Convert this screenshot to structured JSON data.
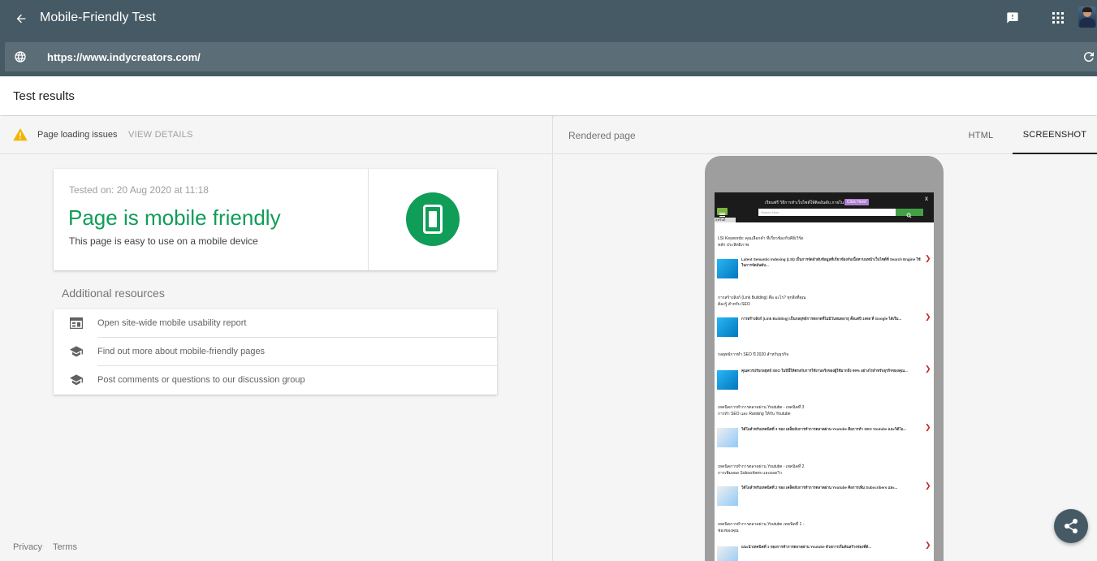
{
  "app": {
    "title": "Mobile-Friendly Test",
    "url": "https://www.indycreators.com/"
  },
  "results": {
    "title": "Test results"
  },
  "issues": {
    "text": "Page loading issues",
    "action": "VIEW DETAILS"
  },
  "result_card": {
    "tested_on": "Tested on: 20 Aug 2020 at 11:18",
    "verdict": "Page is mobile friendly",
    "subtitle": "This page is easy to use on a mobile device",
    "verdict_color": "#0f9d58"
  },
  "resources": {
    "title": "Additional resources",
    "items": [
      {
        "label": "Open site-wide mobile usability report",
        "icon": "report-icon"
      },
      {
        "label": "Find out more about mobile-friendly pages",
        "icon": "school-icon"
      },
      {
        "label": "Post comments or questions to our discussion group",
        "icon": "school-icon"
      }
    ]
  },
  "footer": {
    "privacy": "Privacy",
    "terms": "Terms"
  },
  "rendered": {
    "title": "Rendered page",
    "tabs": [
      "HTML",
      "SCREENSHOT"
    ],
    "active_tab": "SCREENSHOT"
  },
  "preview": {
    "banner_text": "เรียนฟรี วิธีการทำเว็บไซต์ให้ติดอันดับ ภายใน 1 วัน",
    "click_here": "Click Here!",
    "close": "x",
    "search_placeholder": "Search Here",
    "lang": "สคริปต์",
    "posts": [
      {
        "title": "LSI Keywords: คุณเลือกคำ ที่เกี่ยวข้องกับคีย์เวิร์ดหลัก ประสิทธิภาพ",
        "excerpt": "Latent Semantic Indexing (LSI) เป็นการจัดลำดับข้อมูลที่เกี่ยวข้องกับเนื้อหาบนหน้าเว็บไซต์ที่ Search Engine ใช้ในการจัดอันดับ..."
      },
      {
        "title": "การสร้างลิงก์ (Link Building) คือ อะไร? ทุกสิ่งที่คุณต้องรู้ สำหรับ SEO",
        "excerpt": "การสร้างลิงก์ (Link Building) เป็นกลยุทธ์การตลาดที่ไม่มีวันหมดอายุ ตั้งแต่ปี 1998 ที่ Google ได้เริ่ม..."
      },
      {
        "title": "กลยุทธ์การทำ SEO ปี 2020 สำหรับธุรกิจ",
        "excerpt": "คุณควรปรับกลยุทธ์ SEO ในปีนี้ให้ตรงกับการใช้งานจริงของผู้ใช้มากถึง 99% อย่างไรสำหรับธุรกิจของคุณ..."
      },
      {
        "title": "เทคนิคการทำการตลาดผ่าน Youtube - เทคนิคที่ 3 การทำ SEO และ Ranking ให้กับ Youtube",
        "excerpt": "วิดีโอสำหรับเทคนิคที่ 3 ของ เคล็ดลับการทำการตลาดผ่าน Youtube คือการทำ SEO Youtube และวิดีโอ..."
      },
      {
        "title": "เทคนิคการทำการตลาดผ่าน Youtube - เทคนิคที่ 2 การเพิ่มยอด Subscribers และยอดวิว",
        "excerpt": "วิดีโอสำหรับเทคนิคที่ 2 ของ เคล็ดลับการทำการตลาดผ่าน Youtube คือการเพิ่ม Subscribers และ..."
      },
      {
        "title": "เทคนิคการทำการตลาดผ่าน Youtube เทคนิคที่ 1 - ช่องของคุณ",
        "excerpt": "แนะนำเทคนิคที่ 1 ของการทำการตลาดผ่าน Youtube ด้วยการเริ่มต้นสร้างช่องที่ดี..."
      }
    ]
  }
}
